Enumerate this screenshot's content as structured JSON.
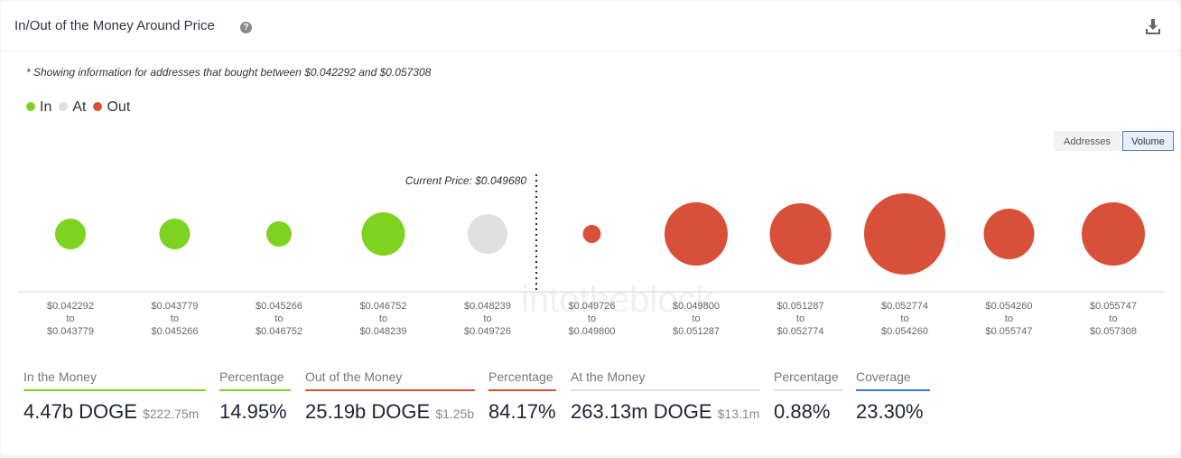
{
  "header": {
    "title": "In/Out of the Money Around Price",
    "help_icon": "?"
  },
  "note": "* Showing information for addresses that bought between $0.042292 and $0.057308",
  "legend": [
    {
      "label": "In",
      "color": "#7ed321"
    },
    {
      "label": "At",
      "color": "#e0e0e0"
    },
    {
      "label": "Out",
      "color": "#d9503a"
    }
  ],
  "toggle": {
    "addresses": "Addresses",
    "volume": "Volume",
    "selected": "Volume"
  },
  "chart_data": {
    "type": "scatter",
    "title": "In/Out of the Money Around Price",
    "current_price_label": "Current Price: $0.049680",
    "current_price": 0.04968,
    "watermark": "intotheblock",
    "bins": [
      {
        "from": "$0.042292",
        "to": "$0.043779",
        "status": "in",
        "relative_volume": 14.3
      },
      {
        "from": "$0.043779",
        "to": "$0.045266",
        "status": "in",
        "relative_volume": 14.3
      },
      {
        "from": "$0.045266",
        "to": "$0.046752",
        "status": "in",
        "relative_volume": 9.7
      },
      {
        "from": "$0.046752",
        "to": "$0.048239",
        "status": "in",
        "relative_volume": 28.4
      },
      {
        "from": "$0.048239",
        "to": "$0.049726",
        "status": "at",
        "relative_volume": 23.9
      },
      {
        "from": "$0.049726",
        "to": "$0.049800",
        "status": "out",
        "relative_volume": 4.9
      },
      {
        "from": "$0.049800",
        "to": "$0.051287",
        "status": "out",
        "relative_volume": 60.5
      },
      {
        "from": "$0.051287",
        "to": "$0.052774",
        "status": "out",
        "relative_volume": 57.1
      },
      {
        "from": "$0.052774",
        "to": "$0.054260",
        "status": "out",
        "relative_volume": 100
      },
      {
        "from": "$0.054260",
        "to": "$0.055747",
        "status": "out",
        "relative_volume": 38.7
      },
      {
        "from": "$0.055747",
        "to": "$0.057308",
        "status": "out",
        "relative_volume": 60.5
      }
    ],
    "to_word": "to"
  },
  "stats": [
    {
      "label": "In the Money",
      "value": "4.47b DOGE",
      "sub": "$222.75m",
      "color": "#7ed321"
    },
    {
      "label": "Percentage",
      "value": "14.95%",
      "sub": "",
      "color": "#7ed321"
    },
    {
      "label": "Out of the Money",
      "value": "25.19b DOGE",
      "sub": "$1.25b",
      "color": "#d9503a"
    },
    {
      "label": "Percentage",
      "value": "84.17%",
      "sub": "",
      "color": "#d9503a"
    },
    {
      "label": "At the Money",
      "value": "263.13m DOGE",
      "sub": "$13.1m",
      "color": "#e0e0e0"
    },
    {
      "label": "Percentage",
      "value": "0.88%",
      "sub": "",
      "color": "#e0e0e0"
    },
    {
      "label": "Coverage",
      "value": "23.30%",
      "sub": "",
      "color": "#3b7be0"
    }
  ]
}
